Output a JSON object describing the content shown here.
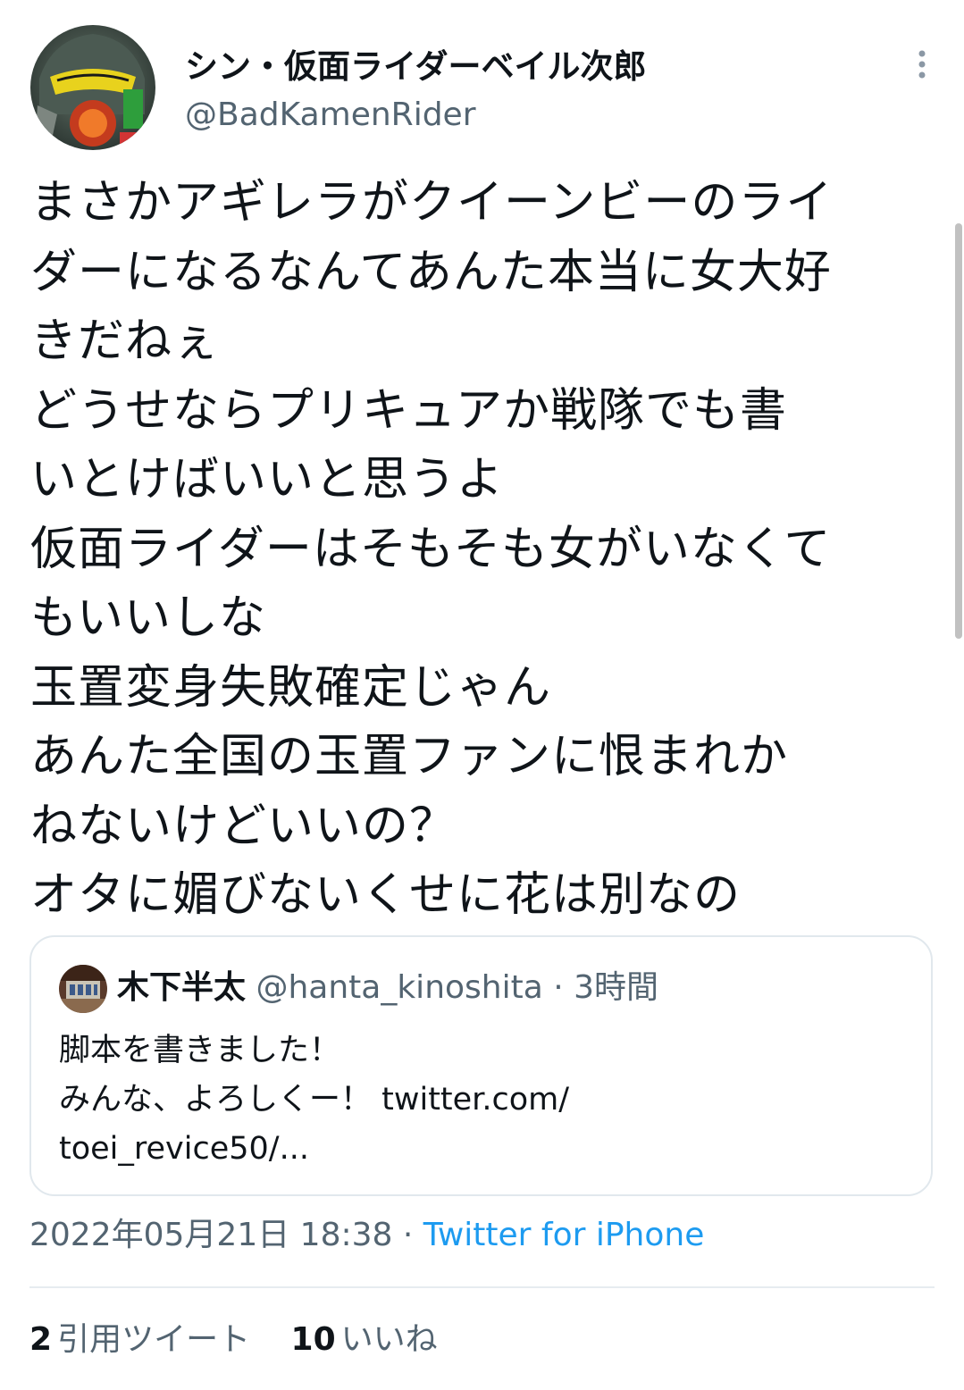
{
  "author": {
    "display_name": "シン・仮面ライダーベイル次郎",
    "handle": "@BadKamenRider"
  },
  "tweet": {
    "lines": [
      "まさかアギレラがクイーンビーのライ",
      "ダーになるなんてあんた本当に女大好",
      "きだねぇ",
      "どうせならプリキュアか戦隊でも書",
      "いとけばいいと思うよ",
      "仮面ライダーはそもそも女がいなくて",
      "もいいしな",
      "玉置変身失敗確定じゃん",
      "あんた全国の玉置ファンに恨まれか",
      "ねないけどいいの？",
      "オタに媚びないくせに花は別なの"
    ]
  },
  "quote": {
    "name": "木下半太",
    "handle": "@hanta_kinoshita",
    "separator": "·",
    "time": "3時間",
    "lines": [
      "脚本を書きました！",
      "みんな、よろしくー！ twitter.com/",
      "toei_revice50/..."
    ]
  },
  "meta": {
    "timestamp": "2022年05月21日 18:38",
    "separator": "·",
    "client": "Twitter for iPhone"
  },
  "stats": {
    "quote_count": "2",
    "quote_label": "引用ツイート",
    "like_count": "10",
    "like_label": "いいね"
  },
  "icons": {
    "more": "more-vertical-icon"
  }
}
